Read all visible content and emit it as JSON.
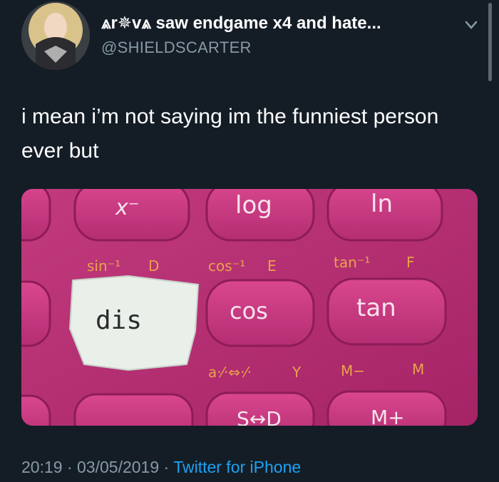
{
  "tweet": {
    "display_name": "⩓r✵v⩓ saw endgame x4 and hate...",
    "handle": "@SHIELDSCARTER",
    "text": "i mean i’m not saying im the funniest person ever but",
    "time": "20:19",
    "date": "03/05/2019",
    "source": "Twitter for iPhone",
    "separator": "·"
  },
  "photo": {
    "keys_top": [
      "x⁻",
      "log",
      "ln"
    ],
    "labels_row1": [
      "sin⁻¹",
      "D",
      "cos⁻¹",
      "E",
      "tan⁻¹",
      "F"
    ],
    "keys_mid": [
      "cos",
      "tan"
    ],
    "paper_note": "dis",
    "labels_row2": [
      "a·⁄·⇔·⁄·",
      "Y",
      "M−",
      "M"
    ],
    "keys_bottom": [
      "S↔D",
      "M+"
    ]
  },
  "colors": {
    "background": "#141d26",
    "secondary_text": "#8899a6",
    "link": "#1da1f2",
    "calculator_pink": "#b72c73"
  }
}
